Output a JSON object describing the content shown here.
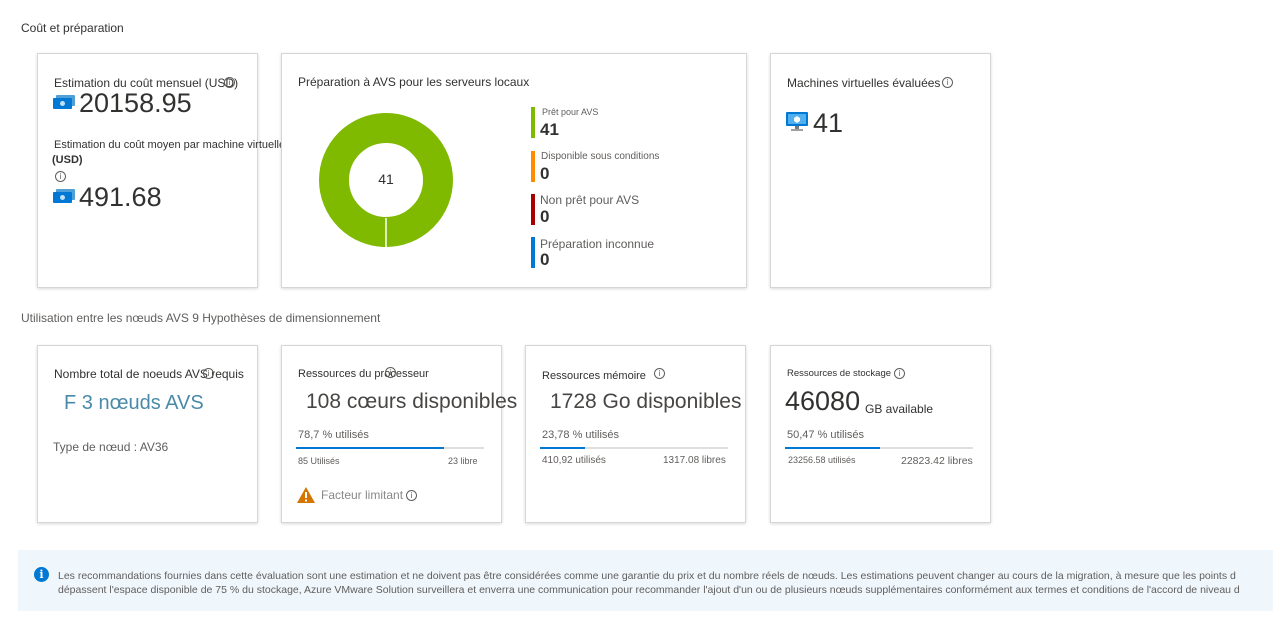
{
  "sections": {
    "cost_title": "Coût et préparation",
    "usage_title": "Utilisation entre les nœuds AVS 9 Hypothèses de dimensionnement"
  },
  "cost_card": {
    "monthly_label": "Estimation du coût mensuel (USD)",
    "monthly_value": "20158.95",
    "avg_label_line1": "Estimation du coût moyen par machine virtuelle",
    "avg_label_line2": "(USD)",
    "avg_value": "491.68"
  },
  "readiness_card": {
    "title": "Préparation à AVS pour les serveurs locaux",
    "donut_total": "41",
    "legend": [
      {
        "label": "Prêt pour AVS",
        "value": "41",
        "color": "#7fba00"
      },
      {
        "label": "Disponible sous conditions",
        "value": "0",
        "color": "#ff8c00"
      },
      {
        "label": "Non prêt pour AVS",
        "value": "0",
        "color": "#a80000"
      },
      {
        "label": "Préparation inconnue",
        "value": "0",
        "color": "#0078d4"
      }
    ]
  },
  "vm_card": {
    "title": "Machines virtuelles évaluées",
    "value": "41"
  },
  "nodes_card": {
    "title": "Nombre total de noeuds AVS requis",
    "value": "F 3 nœuds AVS",
    "node_type": "Type de nœud : AV36"
  },
  "cpu_card": {
    "title": "Ressources du processeur",
    "value": "108 cœurs disponibles",
    "used_pct_label": "78,7 % utilisés",
    "used_fraction": 0.787,
    "used_label": "85 Utilisés",
    "free_label": "23 libre",
    "limiting": "Facteur limitant"
  },
  "memory_card": {
    "title": "Ressources mémoire",
    "value": "1728 Go disponibles",
    "used_pct_label": "23,78 % utilisés",
    "used_fraction": 0.2378,
    "used_label": "410,92 utilisés",
    "free_label": "1317.08 libres"
  },
  "storage_card": {
    "title": "Ressources de stockage",
    "value": "46080",
    "unit": "GB available",
    "used_pct_label": "50,47 % utilisés",
    "used_fraction": 0.5047,
    "used_label": "23256.58 utilisés",
    "free_label": "22823.42 libres"
  },
  "banner": {
    "line1": "Les recommandations fournies dans cette évaluation sont une estimation et ne doivent pas être considérées comme une garantie du prix et du nombre réels de nœuds. Les estimations peuvent changer au cours de la migration, à mesure que les points d",
    "line2": "dépassent l'espace disponible de 75 % du stockage, Azure VMware Solution surveillera et enverra une communication pour recommander l'ajout d'un ou de plusieurs nœuds supplémentaires conformément aux termes et conditions de l'accord de niveau d"
  },
  "colors": {
    "accent": "#0078d4",
    "ready": "#7fba00",
    "conditional": "#ff8c00",
    "not_ready": "#a80000",
    "nodes_text": "#4a8aa8"
  }
}
